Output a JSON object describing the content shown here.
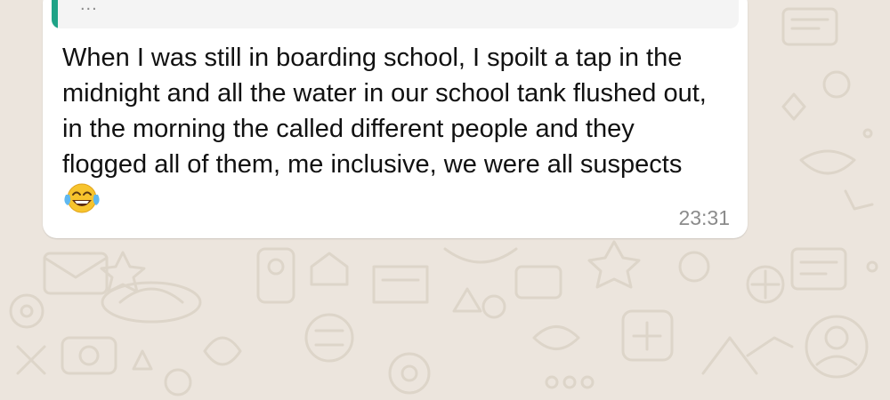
{
  "chat": {
    "quoted_preview": "...",
    "message_text": "When I was still in boarding school, I spoilt a tap in the midnight and all the water in our school tank flushed out, in the morning the called different people and they flogged all of them, me inclusive, we were all suspects",
    "emoji": "face-with-tears-of-joy",
    "timestamp": "23:31"
  },
  "colors": {
    "wallpaper": "#ece5dd",
    "bubble": "#ffffff",
    "quote_bar": "#1fa387",
    "timestamp": "#8b8b8b"
  }
}
